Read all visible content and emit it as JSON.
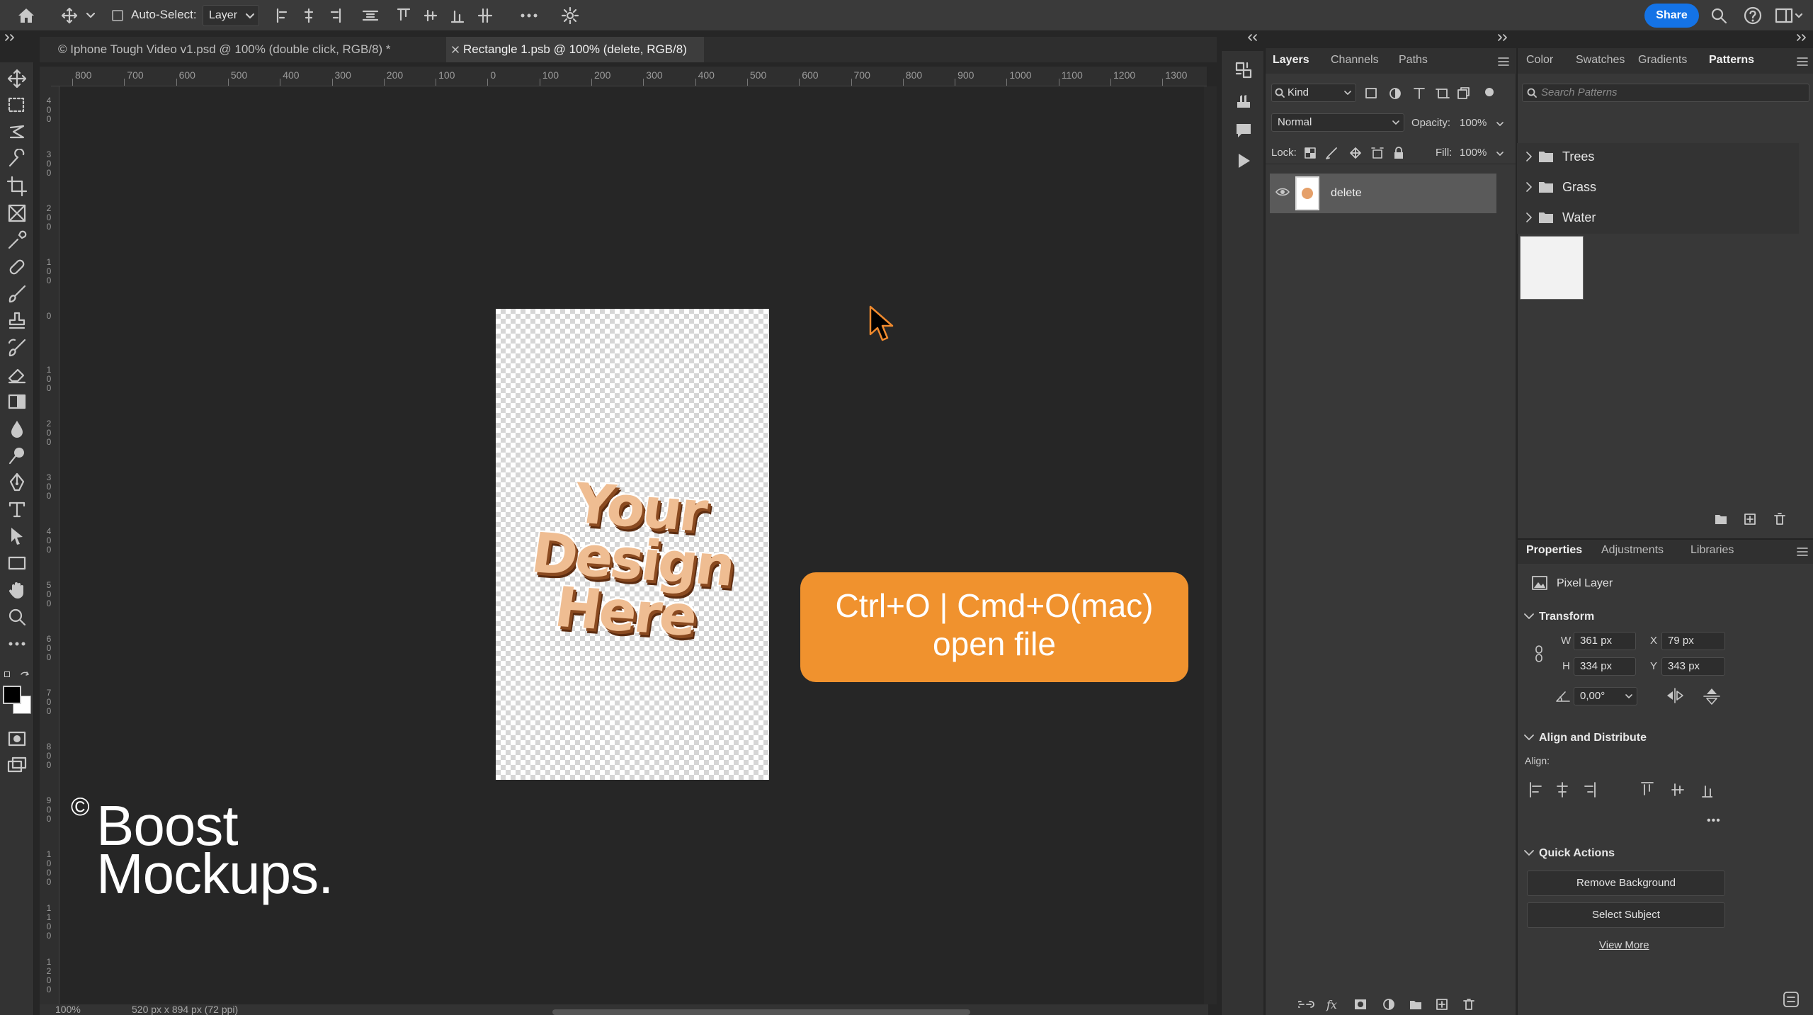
{
  "options_bar": {
    "auto_select_label": "Auto-Select:",
    "auto_select_value": "Layer",
    "share_label": "Share",
    "icons": [
      "home-icon",
      "move-tool-icon",
      "align-icons",
      "more-icon",
      "settings-icon",
      "search-icon",
      "help-icon",
      "workspace-icon"
    ]
  },
  "tabs": [
    {
      "label": "© Iphone Tough Video v1.psd @ 100% (double click, RGB/8) *",
      "active": false
    },
    {
      "label": "Rectangle 1.psb @ 100% (delete, RGB/8)",
      "active": true
    }
  ],
  "ruler": {
    "h_labels": [
      "800",
      "700",
      "600",
      "500",
      "400",
      "300",
      "200",
      "100",
      "0",
      "100",
      "200",
      "300",
      "400",
      "500",
      "600",
      "700",
      "800",
      "900",
      "1000",
      "1100",
      "1200",
      "1300"
    ],
    "v_labels": [
      "400",
      "300",
      "200",
      "100",
      "0",
      "100",
      "200",
      "300",
      "400",
      "500",
      "600",
      "700",
      "800",
      "900",
      "1000",
      "1100",
      "1200"
    ]
  },
  "canvas": {
    "design_text": [
      "Your",
      "Design",
      "Here"
    ],
    "callout_line1": "Ctrl+O | Cmd+O(mac)",
    "callout_line2": "open file",
    "callout_color": "#f0922e",
    "watermark_symbol": "©",
    "watermark_line1": "Boost",
    "watermark_line2": "Mockups."
  },
  "status": {
    "zoom": "100%",
    "doc_info": "520 px x 894 px (72 ppi)"
  },
  "layers_panel": {
    "tabs": [
      "Layers",
      "Channels",
      "Paths"
    ],
    "kind_label": "Kind",
    "blend_mode": "Normal",
    "opacity_label": "Opacity:",
    "opacity_value": "100%",
    "lock_label": "Lock:",
    "fill_label": "Fill:",
    "fill_value": "100%",
    "layer_name": "delete"
  },
  "patterns_panel": {
    "tabs": [
      "Color",
      "Swatches",
      "Gradients",
      "Patterns"
    ],
    "search_placeholder": "Search Patterns",
    "groups": [
      "Trees",
      "Grass",
      "Water"
    ]
  },
  "properties_panel": {
    "tabs": [
      "Properties",
      "Adjustments",
      "Libraries"
    ],
    "layer_type": "Pixel Layer",
    "transform_title": "Transform",
    "w_label": "W",
    "w_value": "361 px",
    "h_label": "H",
    "h_value": "334 px",
    "x_label": "X",
    "x_value": "79 px",
    "y_label": "Y",
    "y_value": "343 px",
    "angle_value": "0,00°",
    "align_title": "Align and Distribute",
    "align_label": "Align:",
    "more_label": "•••",
    "quick_title": "Quick Actions",
    "remove_bg_label": "Remove Background",
    "select_subject_label": "Select Subject",
    "view_more_label": "View More"
  },
  "accent_color": "#1473e6"
}
